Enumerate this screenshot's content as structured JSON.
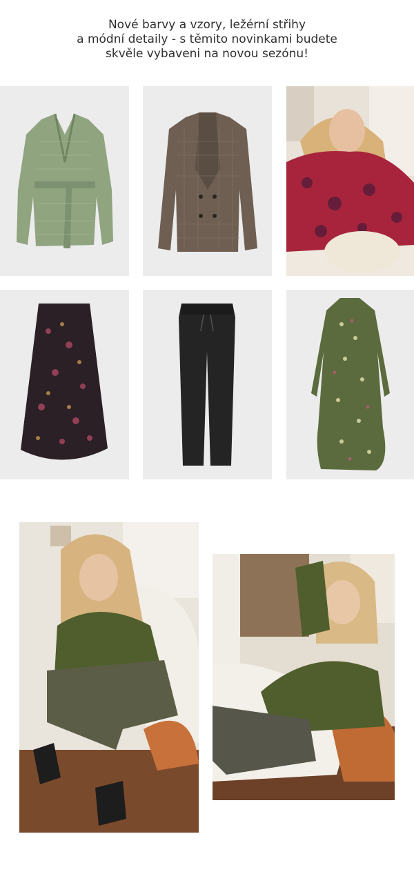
{
  "intro": {
    "lines": [
      "Nové barvy a vzory, ležérní střihy",
      "a módní detaily - s těmito novinkami budete",
      "skvěle vybaveni na novou sezónu!"
    ]
  },
  "products": [
    {
      "icon": "green-wrap-cardigan-icon"
    },
    {
      "icon": "checked-double-breasted-blazer-icon"
    },
    {
      "icon": "model-in-floral-dress-icon"
    },
    {
      "icon": "floral-maxi-skirt-icon"
    },
    {
      "icon": "black-jogger-trousers-icon"
    },
    {
      "icon": "floral-shirt-dress-icon"
    }
  ],
  "lookbook": [
    {
      "icon": "model-green-sweater-sitting-icon"
    },
    {
      "icon": "model-green-sweater-lounging-icon"
    }
  ],
  "colors": {
    "text": "#2f2f2f",
    "tile_bg": "#ececec",
    "sweater_green": "#4f5e2c",
    "cardigan_green": "#8fa47f"
  }
}
